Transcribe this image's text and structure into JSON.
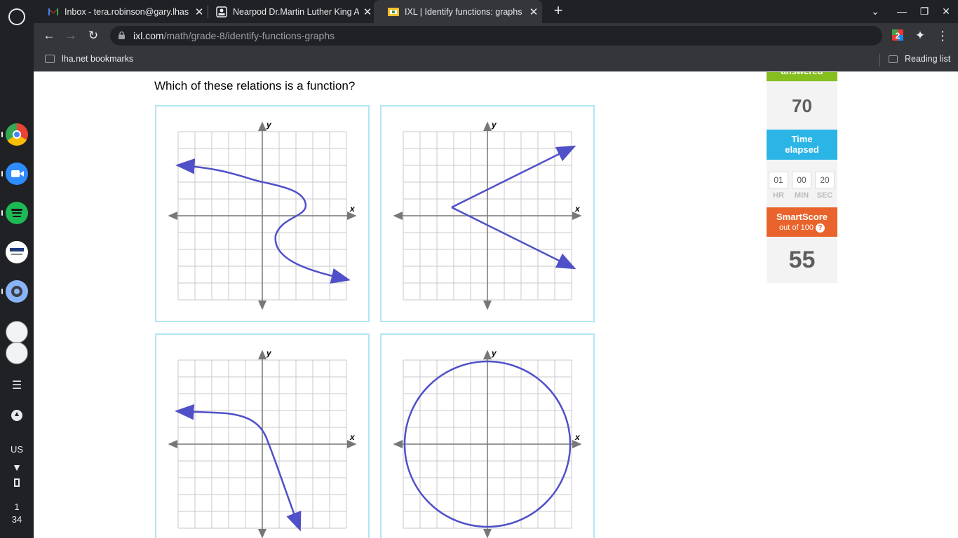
{
  "shelf": {
    "locale": "US",
    "time_hour": "1",
    "time_minute": "34"
  },
  "tabs": [
    {
      "title": "Inbox - tera.robinson@gary.lhas"
    },
    {
      "title": "Nearpod Dr.Martin Luther King A"
    },
    {
      "title": "IXL | Identify functions: graphs | I"
    }
  ],
  "address_bar": {
    "host": "ixl.com",
    "path": "/math/grade-8/identify-functions-graphs"
  },
  "bookmarks_bar": {
    "folder": "lha.net bookmarks",
    "reading_list": "Reading list"
  },
  "question": {
    "prompt": "Which of these relations is a function?",
    "axis_x": "x",
    "axis_y": "y"
  },
  "sidebar": {
    "answered_label": "answered",
    "answered_value": "70",
    "time_label_1": "Time",
    "time_label_2": "elapsed",
    "time_hr": "01",
    "time_min": "00",
    "time_sec": "20",
    "hr_label": "HR",
    "min_label": "MIN",
    "sec_label": "SEC",
    "smartscore_label": "SmartScore",
    "smartscore_sub": "out of 100",
    "help": "?",
    "smartscore_value": "55"
  },
  "colors": {
    "curve": "#5050c8",
    "answered": "#84be1f",
    "time": "#2ab5e6",
    "smartscore": "#e8642c"
  }
}
